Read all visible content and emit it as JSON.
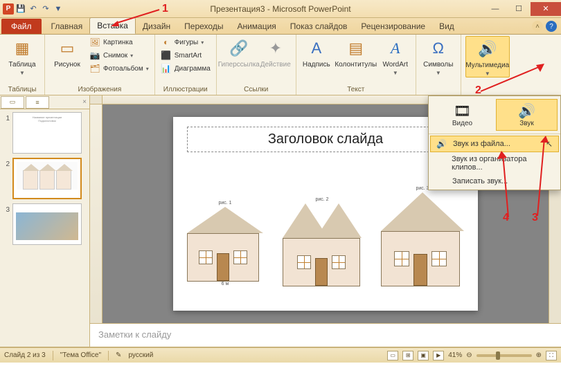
{
  "title": "Презентация3 - Microsoft PowerPoint",
  "qat": {
    "app": "P"
  },
  "tabs": {
    "file": "Файл",
    "items": [
      "Главная",
      "Вставка",
      "Дизайн",
      "Переходы",
      "Анимация",
      "Показ слайдов",
      "Рецензирование",
      "Вид"
    ],
    "active_index": 1
  },
  "ribbon": {
    "tables": {
      "btn": "Таблица",
      "label": "Таблицы"
    },
    "images": {
      "btn": "Рисунок",
      "small": [
        "Картинка",
        "Снимок",
        "Фотоальбом"
      ],
      "label": "Изображения"
    },
    "illustr": {
      "small": [
        "Фигуры",
        "SmartArt",
        "Диаграмма"
      ],
      "label": "Иллюстрации"
    },
    "links": {
      "btn1": "Гиперссылка",
      "btn2": "Действие",
      "label": "Ссылки"
    },
    "text": {
      "btns": [
        "Надпись",
        "Колонтитулы",
        "WordArt"
      ],
      "label": "Текст"
    },
    "symbols": {
      "btn": "Символы"
    },
    "media": {
      "btn": "Мультимедиа"
    }
  },
  "popup": {
    "video": "Видео",
    "audio": "Звук",
    "items": [
      "Звук из файла...",
      "Звук из организатора клипов...",
      "Записать звук..."
    ]
  },
  "slide": {
    "title": "Заголовок слайда",
    "captions": [
      "рис. 1",
      "рис. 2",
      "рис. 3"
    ],
    "dim_w": "6 м"
  },
  "thumbs": {
    "t1_line1": "Название презентации",
    "t1_line2": "Подзаголовок",
    "notes": "Заметки к слайду"
  },
  "status": {
    "slide": "Слайд 2 из 3",
    "theme": "\"Тема Office\"",
    "lang": "русский",
    "zoom": "41%"
  },
  "anno": {
    "n1": "1",
    "n2": "2",
    "n3": "3",
    "n4": "4"
  }
}
